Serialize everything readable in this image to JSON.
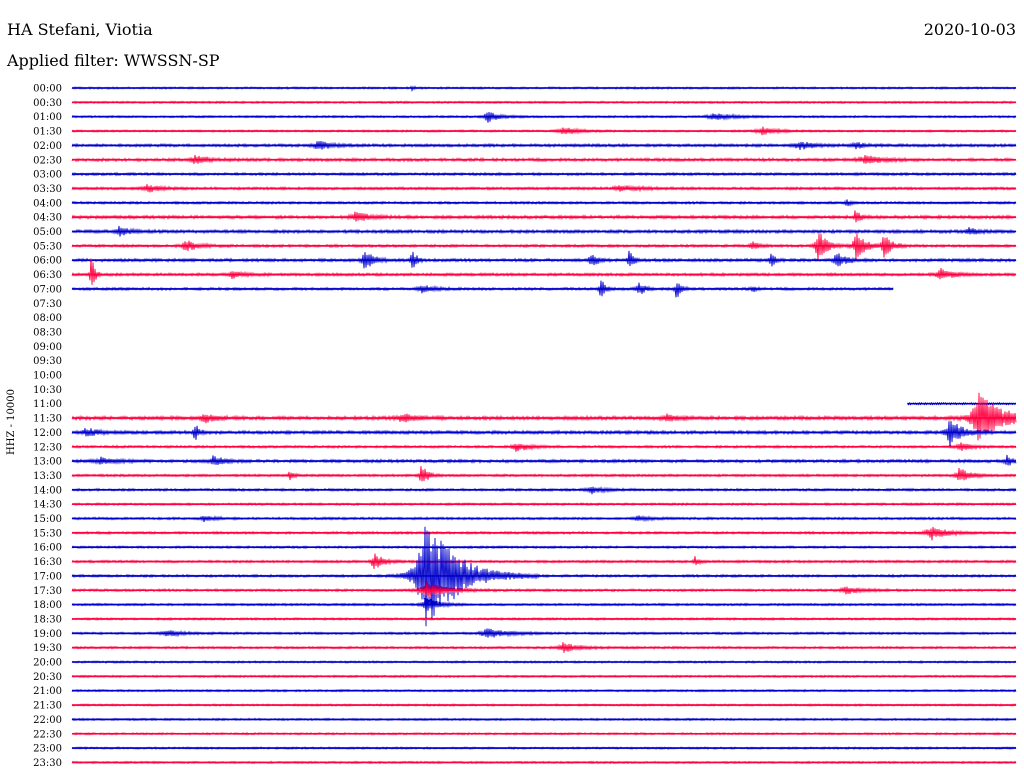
{
  "header": {
    "station": "HA Stefani, Viotia",
    "date": "2020-10-03",
    "filter": "Applied filter: WWSSN-SP"
  },
  "chart_data": {
    "type": "line",
    "title": "HA Stefani, Viotia",
    "subtitle": "Applied filter: WWSSN-SP",
    "ylabel": "HHZ - 10000",
    "xlabel": "",
    "colors": [
      "#0000cc",
      "#ff0040"
    ],
    "grid": false,
    "rows": [
      {
        "label": "00:00",
        "color": "#0000cc",
        "start": 0.0,
        "end": 1.0,
        "noise": 1.0,
        "events": [
          {
            "pos": 0.36,
            "amp": 2,
            "width": 0.004
          }
        ]
      },
      {
        "label": "00:30",
        "color": "#ff0040",
        "start": 0.0,
        "end": 1.0,
        "noise": 1.0,
        "events": []
      },
      {
        "label": "01:00",
        "color": "#0000cc",
        "start": 0.0,
        "end": 1.0,
        "noise": 1.0,
        "events": [
          {
            "pos": 0.44,
            "amp": 6,
            "width": 0.01
          },
          {
            "pos": 0.68,
            "amp": 3,
            "width": 0.02
          }
        ]
      },
      {
        "label": "01:30",
        "color": "#ff0040",
        "start": 0.0,
        "end": 1.0,
        "noise": 1.0,
        "events": [
          {
            "pos": 0.52,
            "amp": 4,
            "width": 0.015
          },
          {
            "pos": 0.73,
            "amp": 4,
            "width": 0.015
          }
        ]
      },
      {
        "label": "02:00",
        "color": "#0000cc",
        "start": 0.0,
        "end": 1.0,
        "noise": 1.4,
        "events": [
          {
            "pos": 0.26,
            "amp": 5,
            "width": 0.012
          },
          {
            "pos": 0.77,
            "amp": 5,
            "width": 0.012
          },
          {
            "pos": 0.83,
            "amp": 3,
            "width": 0.01
          }
        ]
      },
      {
        "label": "02:30",
        "color": "#ff0040",
        "start": 0.0,
        "end": 1.0,
        "noise": 1.5,
        "events": [
          {
            "pos": 0.13,
            "amp": 5,
            "width": 0.012
          },
          {
            "pos": 0.84,
            "amp": 4,
            "width": 0.02
          }
        ]
      },
      {
        "label": "03:00",
        "color": "#0000cc",
        "start": 0.0,
        "end": 1.0,
        "noise": 1.3,
        "events": []
      },
      {
        "label": "03:30",
        "color": "#ff0040",
        "start": 0.0,
        "end": 1.0,
        "noise": 1.3,
        "events": [
          {
            "pos": 0.08,
            "amp": 4,
            "width": 0.012
          },
          {
            "pos": 0.58,
            "amp": 3,
            "width": 0.02
          }
        ]
      },
      {
        "label": "04:00",
        "color": "#0000cc",
        "start": 0.0,
        "end": 1.0,
        "noise": 1.2,
        "events": [
          {
            "pos": 0.82,
            "amp": 4,
            "width": 0.005
          }
        ]
      },
      {
        "label": "04:30",
        "color": "#ff0040",
        "start": 0.0,
        "end": 1.0,
        "noise": 1.6,
        "events": [
          {
            "pos": 0.3,
            "amp": 5,
            "width": 0.015
          },
          {
            "pos": 0.83,
            "amp": 10,
            "width": 0.004
          }
        ]
      },
      {
        "label": "05:00",
        "color": "#0000cc",
        "start": 0.0,
        "end": 1.0,
        "noise": 1.6,
        "events": [
          {
            "pos": 0.05,
            "amp": 5,
            "width": 0.01
          },
          {
            "pos": 0.95,
            "amp": 4,
            "width": 0.01
          }
        ]
      },
      {
        "label": "05:30",
        "color": "#ff0040",
        "start": 0.0,
        "end": 1.0,
        "noise": 1.3,
        "events": [
          {
            "pos": 0.12,
            "amp": 6,
            "width": 0.012
          },
          {
            "pos": 0.72,
            "amp": 5,
            "width": 0.006
          },
          {
            "pos": 0.79,
            "amp": 18,
            "width": 0.008
          },
          {
            "pos": 0.83,
            "amp": 14,
            "width": 0.01
          },
          {
            "pos": 0.86,
            "amp": 12,
            "width": 0.008
          }
        ]
      },
      {
        "label": "06:00",
        "color": "#0000cc",
        "start": 0.0,
        "end": 1.0,
        "noise": 1.5,
        "events": [
          {
            "pos": 0.31,
            "amp": 12,
            "width": 0.008
          },
          {
            "pos": 0.36,
            "amp": 14,
            "width": 0.004
          },
          {
            "pos": 0.55,
            "amp": 8,
            "width": 0.006
          },
          {
            "pos": 0.59,
            "amp": 10,
            "width": 0.004
          },
          {
            "pos": 0.74,
            "amp": 10,
            "width": 0.004
          },
          {
            "pos": 0.81,
            "amp": 10,
            "width": 0.008
          }
        ]
      },
      {
        "label": "06:30",
        "color": "#ff0040",
        "start": 0.0,
        "end": 1.0,
        "noise": 1.4,
        "events": [
          {
            "pos": 0.02,
            "amp": 26,
            "width": 0.003
          },
          {
            "pos": 0.17,
            "amp": 5,
            "width": 0.01
          },
          {
            "pos": 0.92,
            "amp": 6,
            "width": 0.012
          }
        ]
      },
      {
        "label": "07:00",
        "color": "#0000cc",
        "start": 0.0,
        "end": 0.87,
        "noise": 1.3,
        "events": [
          {
            "pos": 0.37,
            "amp": 5,
            "width": 0.01
          },
          {
            "pos": 0.56,
            "amp": 14,
            "width": 0.004
          },
          {
            "pos": 0.6,
            "amp": 8,
            "width": 0.006
          },
          {
            "pos": 0.64,
            "amp": 12,
            "width": 0.004
          },
          {
            "pos": 0.72,
            "amp": 4,
            "width": 0.004
          }
        ]
      },
      {
        "label": "07:30",
        "color": "#ff0040",
        "start": 0.0,
        "end": 0.0,
        "noise": 0,
        "events": []
      },
      {
        "label": "08:00",
        "color": "#0000cc",
        "start": 0.0,
        "end": 0.0,
        "noise": 0,
        "events": []
      },
      {
        "label": "08:30",
        "color": "#ff0040",
        "start": 0.0,
        "end": 0.0,
        "noise": 0,
        "events": []
      },
      {
        "label": "09:00",
        "color": "#0000cc",
        "start": 0.0,
        "end": 0.0,
        "noise": 0,
        "events": []
      },
      {
        "label": "09:30",
        "color": "#ff0040",
        "start": 0.0,
        "end": 0.0,
        "noise": 0,
        "events": []
      },
      {
        "label": "10:00",
        "color": "#0000cc",
        "start": 0.0,
        "end": 0.0,
        "noise": 0,
        "events": []
      },
      {
        "label": "10:30",
        "color": "#ff0040",
        "start": 0.0,
        "end": 0.0,
        "noise": 0,
        "events": []
      },
      {
        "label": "11:00",
        "color": "#0000cc",
        "start": 0.885,
        "end": 1.0,
        "noise": 1.0,
        "events": []
      },
      {
        "label": "11:30",
        "color": "#ff0040",
        "start": 0.0,
        "end": 1.0,
        "noise": 1.8,
        "events": [
          {
            "pos": 0.14,
            "amp": 5,
            "width": 0.01
          },
          {
            "pos": 0.35,
            "amp": 4,
            "width": 0.015
          },
          {
            "pos": 0.63,
            "amp": 3,
            "width": 0.015
          },
          {
            "pos": 0.96,
            "amp": 30,
            "width": 0.02
          }
        ]
      },
      {
        "label": "12:00",
        "color": "#0000cc",
        "start": 0.0,
        "end": 1.0,
        "noise": 1.6,
        "events": [
          {
            "pos": 0.015,
            "amp": 5,
            "width": 0.01
          },
          {
            "pos": 0.13,
            "amp": 10,
            "width": 0.004
          },
          {
            "pos": 0.93,
            "amp": 14,
            "width": 0.012
          }
        ]
      },
      {
        "label": "12:30",
        "color": "#ff0040",
        "start": 0.0,
        "end": 1.0,
        "noise": 1.2,
        "events": [
          {
            "pos": 0.47,
            "amp": 5,
            "width": 0.012
          },
          {
            "pos": 0.94,
            "amp": 5,
            "width": 0.01
          }
        ]
      },
      {
        "label": "13:00",
        "color": "#0000cc",
        "start": 0.0,
        "end": 1.0,
        "noise": 1.5,
        "events": [
          {
            "pos": 0.03,
            "amp": 4,
            "width": 0.015
          },
          {
            "pos": 0.15,
            "amp": 6,
            "width": 0.01
          },
          {
            "pos": 0.99,
            "amp": 6,
            "width": 0.006
          }
        ]
      },
      {
        "label": "13:30",
        "color": "#ff0040",
        "start": 0.0,
        "end": 1.0,
        "noise": 1.2,
        "events": [
          {
            "pos": 0.23,
            "amp": 5,
            "width": 0.004
          },
          {
            "pos": 0.37,
            "amp": 12,
            "width": 0.006
          },
          {
            "pos": 0.94,
            "amp": 8,
            "width": 0.01
          }
        ]
      },
      {
        "label": "14:00",
        "color": "#0000cc",
        "start": 0.0,
        "end": 1.0,
        "noise": 1.2,
        "events": [
          {
            "pos": 0.55,
            "amp": 4,
            "width": 0.012
          }
        ]
      },
      {
        "label": "14:30",
        "color": "#ff0040",
        "start": 0.0,
        "end": 1.0,
        "noise": 1.1,
        "events": []
      },
      {
        "label": "15:00",
        "color": "#0000cc",
        "start": 0.0,
        "end": 1.0,
        "noise": 1.2,
        "events": [
          {
            "pos": 0.14,
            "amp": 3,
            "width": 0.01
          },
          {
            "pos": 0.6,
            "amp": 3,
            "width": 0.01
          }
        ]
      },
      {
        "label": "15:30",
        "color": "#ff0040",
        "start": 0.0,
        "end": 1.0,
        "noise": 1.2,
        "events": [
          {
            "pos": 0.91,
            "amp": 8,
            "width": 0.015
          }
        ]
      },
      {
        "label": "16:00",
        "color": "#0000cc",
        "start": 0.0,
        "end": 1.0,
        "noise": 1.1,
        "events": []
      },
      {
        "label": "16:30",
        "color": "#ff0040",
        "start": 0.0,
        "end": 1.0,
        "noise": 1.2,
        "events": [
          {
            "pos": 0.32,
            "amp": 10,
            "width": 0.008
          },
          {
            "pos": 0.66,
            "amp": 5,
            "width": 0.004
          }
        ]
      },
      {
        "label": "17:00",
        "color": "#0000cc",
        "start": 0.0,
        "end": 1.0,
        "noise": 1.2,
        "events": [
          {
            "pos": 0.375,
            "amp": 60,
            "width": 0.03
          }
        ]
      },
      {
        "label": "17:30",
        "color": "#ff0040",
        "start": 0.0,
        "end": 1.0,
        "noise": 1.2,
        "events": [
          {
            "pos": 0.375,
            "amp": 8,
            "width": 0.02
          },
          {
            "pos": 0.82,
            "amp": 4,
            "width": 0.015
          }
        ]
      },
      {
        "label": "18:00",
        "color": "#0000cc",
        "start": 0.0,
        "end": 1.0,
        "noise": 1.1,
        "events": [
          {
            "pos": 0.375,
            "amp": 10,
            "width": 0.01
          }
        ]
      },
      {
        "label": "18:30",
        "color": "#ff0040",
        "start": 0.0,
        "end": 1.0,
        "noise": 1.1,
        "events": []
      },
      {
        "label": "19:00",
        "color": "#0000cc",
        "start": 0.0,
        "end": 1.0,
        "noise": 1.1,
        "events": [
          {
            "pos": 0.1,
            "amp": 3,
            "width": 0.015
          },
          {
            "pos": 0.44,
            "amp": 5,
            "width": 0.02
          }
        ]
      },
      {
        "label": "19:30",
        "color": "#ff0040",
        "start": 0.0,
        "end": 1.0,
        "noise": 1.1,
        "events": [
          {
            "pos": 0.52,
            "amp": 5,
            "width": 0.015
          }
        ]
      },
      {
        "label": "20:00",
        "color": "#0000cc",
        "start": 0.0,
        "end": 1.0,
        "noise": 1.0,
        "events": []
      },
      {
        "label": "20:30",
        "color": "#ff0040",
        "start": 0.0,
        "end": 1.0,
        "noise": 1.0,
        "events": []
      },
      {
        "label": "21:00",
        "color": "#0000cc",
        "start": 0.0,
        "end": 1.0,
        "noise": 1.0,
        "events": []
      },
      {
        "label": "21:30",
        "color": "#ff0040",
        "start": 0.0,
        "end": 1.0,
        "noise": 1.0,
        "events": []
      },
      {
        "label": "22:00",
        "color": "#0000cc",
        "start": 0.0,
        "end": 1.0,
        "noise": 1.0,
        "events": []
      },
      {
        "label": "22:30",
        "color": "#ff0040",
        "start": 0.0,
        "end": 1.0,
        "noise": 1.0,
        "events": []
      },
      {
        "label": "23:00",
        "color": "#0000cc",
        "start": 0.0,
        "end": 1.0,
        "noise": 1.0,
        "events": []
      },
      {
        "label": "23:30",
        "color": "#ff0040",
        "start": 0.0,
        "end": 1.0,
        "noise": 1.0,
        "events": []
      }
    ]
  }
}
